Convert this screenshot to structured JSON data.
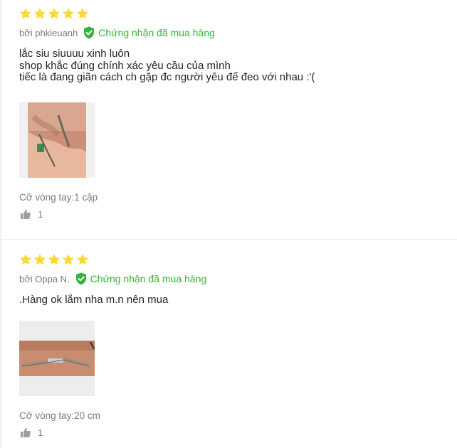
{
  "reviews": [
    {
      "rating": 5,
      "author": "bởi phkieuanh",
      "verified_label": "Chứng nhận đã mua hàng",
      "content": "lắc siu siuuuu xinh luôn\nshop khắc đúng chính xác yêu cầu của mình\ntiếc là đang giãn cách ch gặp đc người yêu để đeo với nhau :'(",
      "variant": "Cỡ vòng tay:1 cặp",
      "likes": "1"
    },
    {
      "rating": 5,
      "author": "bởi Oppa N.",
      "verified_label": "Chứng nhận đã mua hàng",
      "content": ".Hàng ok lắm nha m.n nên mua",
      "variant": "Cỡ vòng tay:20 cm",
      "likes": "1"
    }
  ],
  "colors": {
    "star": "#fdd836",
    "verified": "#34b23a",
    "muted_text": "#7b7b7b"
  },
  "icons": [
    "star-icon",
    "verified-check-icon",
    "thumbs-up-icon"
  ]
}
